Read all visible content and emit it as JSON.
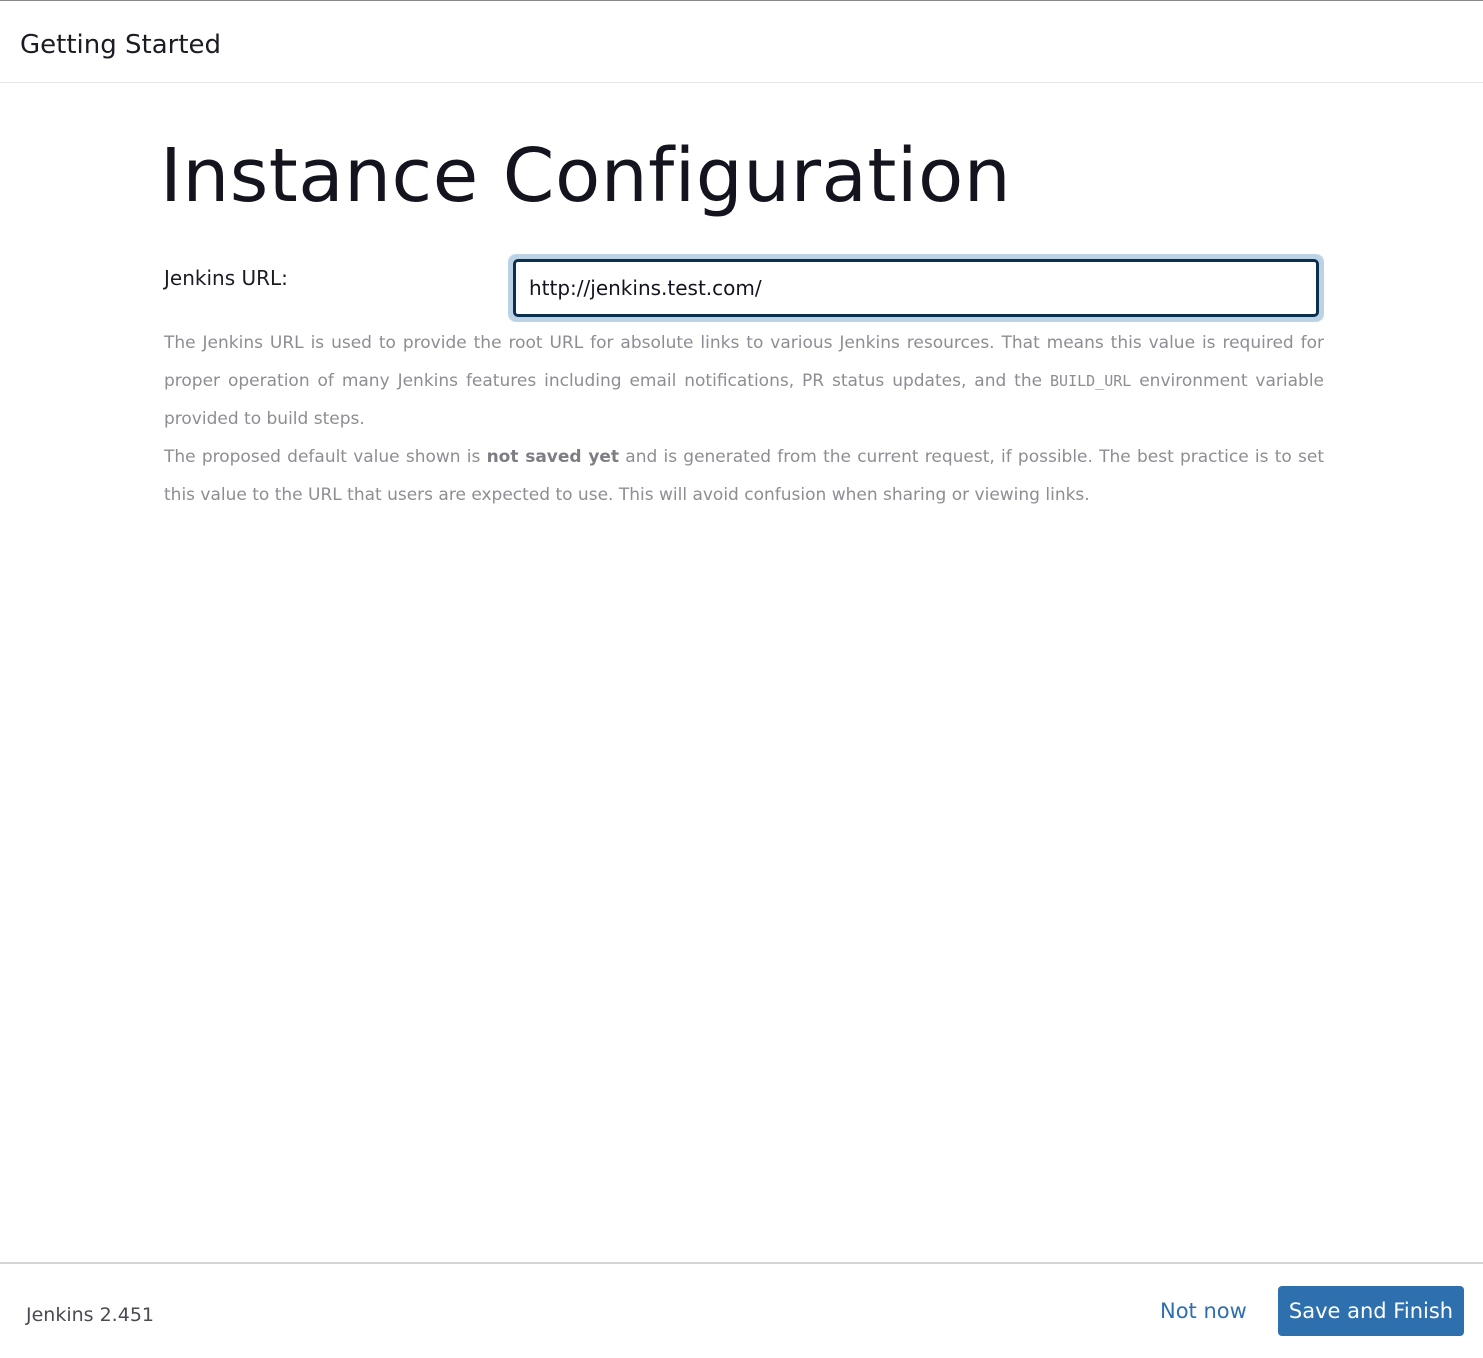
{
  "header": {
    "title": "Getting Started"
  },
  "main": {
    "title": "Instance Configuration",
    "url_label": "Jenkins URL:",
    "url_value": "http://jenkins.test.com/",
    "help": {
      "p1_before": "The Jenkins URL is used to provide the root URL for absolute links to various Jenkins resources. That means this value is required for proper operation of many Jenkins features including email notifications, PR status updates, and the ",
      "p1_code": "BUILD_URL",
      "p1_after": " environment variable provided to build steps.",
      "p2_before": "The proposed default value shown is ",
      "p2_strong": "not saved yet",
      "p2_after": " and is generated from the current request, if possible. The best practice is to set this value to the URL that users are expected to use. This will avoid confusion when sharing or viewing links."
    }
  },
  "footer": {
    "version": "Jenkins 2.451",
    "not_now_label": "Not now",
    "save_finish_label": "Save and Finish"
  },
  "colors": {
    "primary_button": "#2e6fad",
    "link": "#2e6fb0",
    "focus_ring": "#bcd3e6",
    "input_border": "#0d2f4f",
    "help_text": "#8d8d94"
  }
}
